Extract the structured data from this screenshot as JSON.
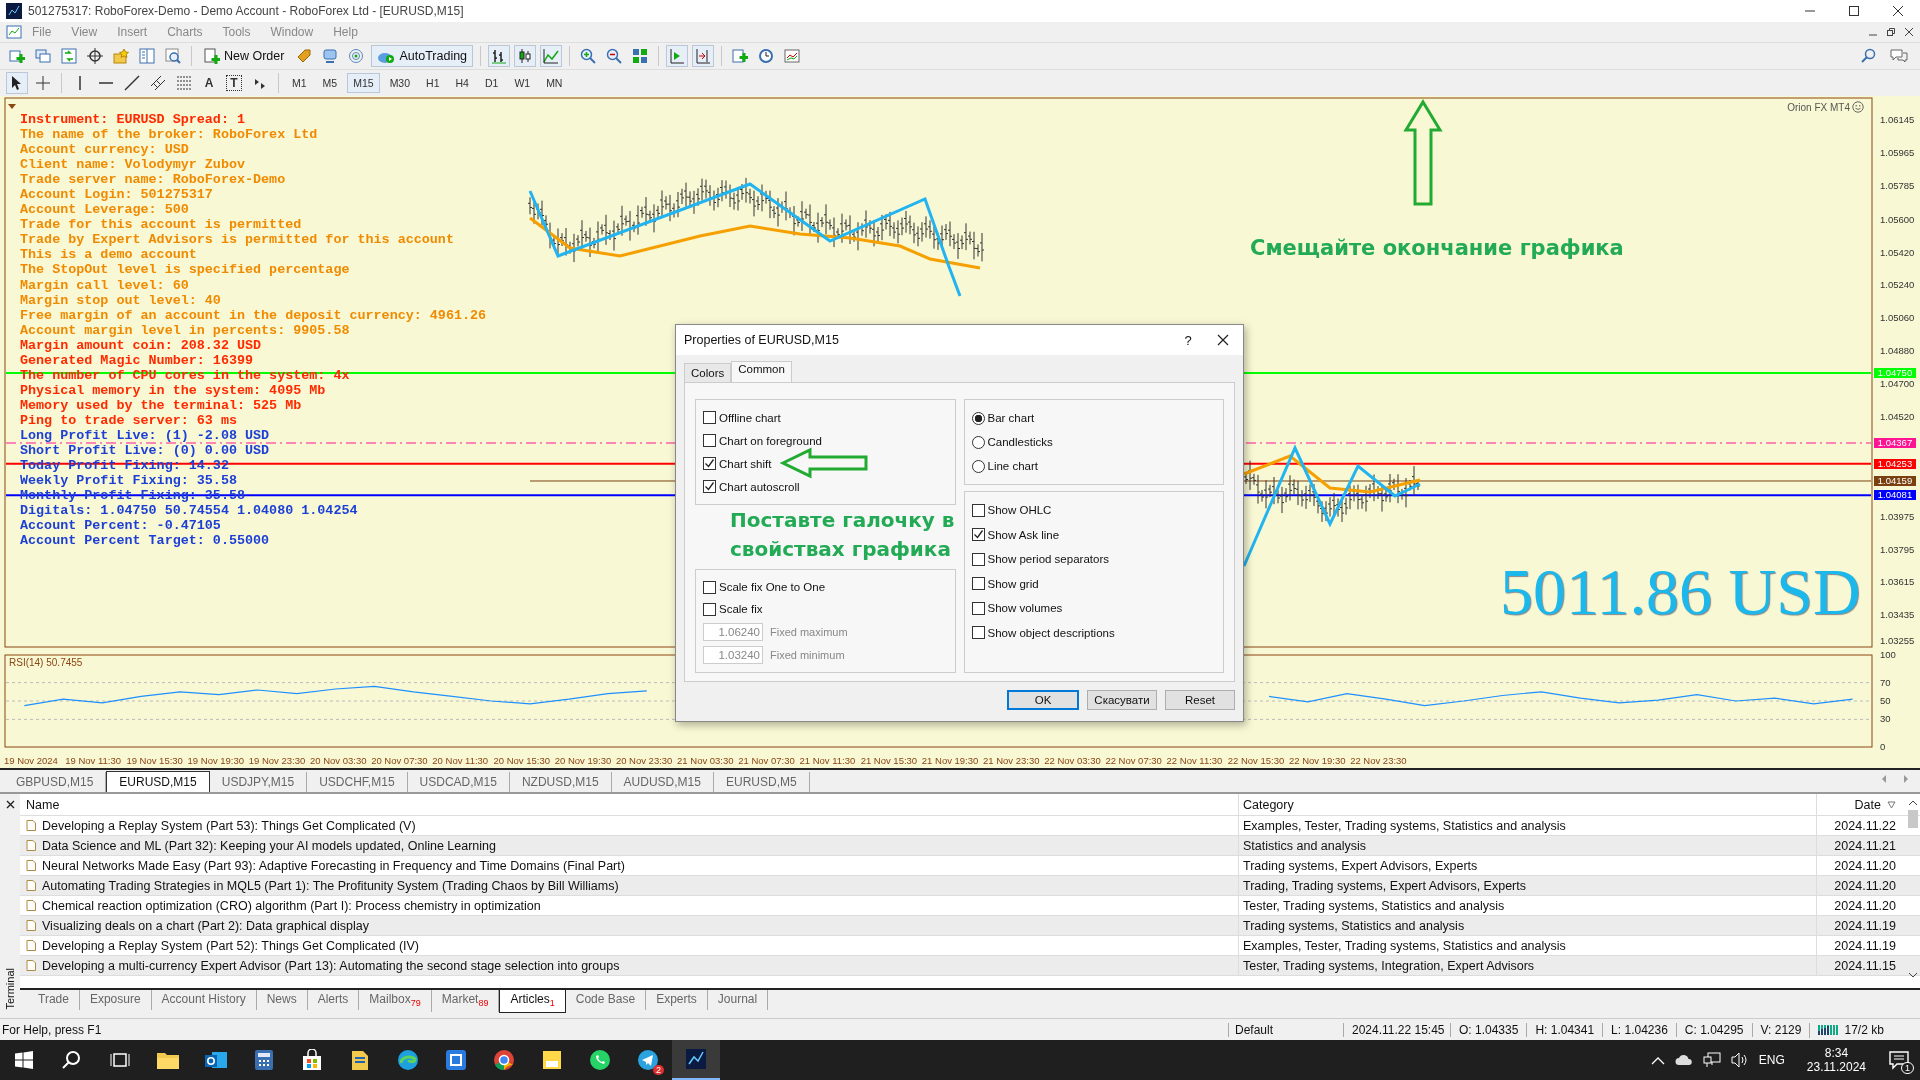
{
  "window": {
    "title": "501275317: RoboForex-Demo - Demo Account - RoboForex Ltd - [EURUSD,M15]"
  },
  "menu": [
    "File",
    "View",
    "Insert",
    "Charts",
    "Tools",
    "Window",
    "Help"
  ],
  "toolbar": {
    "new_order": "New Order",
    "autotrading": "AutoTrading"
  },
  "text_tools": [
    "A",
    "T"
  ],
  "timeframes": [
    {
      "label": "M1",
      "selected": false
    },
    {
      "label": "M5",
      "selected": false
    },
    {
      "label": "M15",
      "selected": true
    },
    {
      "label": "M30",
      "selected": false
    },
    {
      "label": "H1",
      "selected": false
    },
    {
      "label": "H4",
      "selected": false
    },
    {
      "label": "D1",
      "selected": false
    },
    {
      "label": "W1",
      "selected": false
    },
    {
      "label": "MN",
      "selected": false
    }
  ],
  "chart": {
    "info_lines": [
      {
        "text": "Instrument: EURUSD Spread: 1",
        "color": "#ff2a00"
      },
      {
        "text": "The name of the broker: RoboForex Ltd",
        "color": "#f08a00"
      },
      {
        "text": "Account currency: USD",
        "color": "#f08a00"
      },
      {
        "text": "Client name: Volodymyr Zubov",
        "color": "#f08a00"
      },
      {
        "text": "Trade server name: RoboForex-Demo",
        "color": "#f08a00"
      },
      {
        "text": "Account Login: 501275317",
        "color": "#f08a00"
      },
      {
        "text": "Account Leverage: 500",
        "color": "#f08a00"
      },
      {
        "text": "Trade for this account is permitted",
        "color": "#f08a00"
      },
      {
        "text": "Trade by Expert Advisors is permitted for this account",
        "color": "#f08a00"
      },
      {
        "text": "This is a demo account",
        "color": "#f08a00"
      },
      {
        "text": "The StopOut level is specified percentage",
        "color": "#f08a00"
      },
      {
        "text": "Margin call level: 60",
        "color": "#f08a00"
      },
      {
        "text": "Margin stop out level: 40",
        "color": "#f08a00"
      },
      {
        "text": "Free margin of an account in the deposit currency: 4961.26",
        "color": "#f08a00"
      },
      {
        "text": "Account margin level in percents: 9905.58",
        "color": "#f08a00"
      },
      {
        "text": "Margin amount coin: 208.32 USD",
        "color": "#ff2a00"
      },
      {
        "text": "Generated Magic Number: 16399",
        "color": "#ff2a00"
      },
      {
        "text": "The number of CPU cores in the system: 4x",
        "color": "#ff2a00"
      },
      {
        "text": "Physical memory in the system: 4095 Mb",
        "color": "#ff2a00"
      },
      {
        "text": "Memory used by the terminal: 525 Mb",
        "color": "#ff2a00"
      },
      {
        "text": "Ping to trade server: 63 ms",
        "color": "#ff2a00"
      },
      {
        "text": "Long Profit Live: (1) -2.08 USD",
        "color": "#1c3fd6"
      },
      {
        "text": "Short Profit Live: (0) 0.00 USD",
        "color": "#1c3fd6"
      },
      {
        "text": "Today Profit Fixing: 14.32",
        "color": "#1c3fd6"
      },
      {
        "text": "Weekly Profit Fixing: 35.58",
        "color": "#1c3fd6"
      },
      {
        "text": "Monthly Profit Fixing: 35.58",
        "color": "#1c3fd6"
      },
      {
        "text": "Digitals: 1.04750 50.74554 1.04080 1.04254",
        "color": "#1c3fd6"
      },
      {
        "text": "Account Percent: -0.47105",
        "color": "#1c3fd6"
      },
      {
        "text": "Account Percent Target: 0.55000",
        "color": "#1c3fd6"
      }
    ],
    "brand": "Orion FX MT4",
    "hint": "Смещайте окончание графика",
    "balance": "5011.86 USD",
    "price_axis": [
      "1.06145",
      "1.05965",
      "1.05785",
      "1.05600",
      "1.05420",
      "1.05240",
      "1.05060",
      "1.04880",
      "1.04700",
      "1.04520",
      "1.03975",
      "1.03795",
      "1.03615",
      "1.03435",
      "1.03255"
    ],
    "levels": [
      {
        "value": "1.04750",
        "color": "#00ff00",
        "kind": "solid"
      },
      {
        "value": "1.04367",
        "color": "#ff1493",
        "kind": "dashed"
      },
      {
        "value": "1.04253",
        "color": "#ff0000",
        "kind": "solid"
      },
      {
        "value": "1.04159",
        "color": "#7a4010",
        "kind": "short"
      },
      {
        "value": "1.04081",
        "color": "#0000ff",
        "kind": "solid"
      }
    ]
  },
  "rsi": {
    "chart_data": {
      "type": "line",
      "title": "RSI(14) 50.7455",
      "ylim": [
        0,
        100
      ],
      "yticks": [
        100,
        70,
        50,
        30,
        0
      ],
      "grid": true,
      "series": [
        {
          "color": "#1e90ff",
          "values": [
            45,
            52,
            48,
            55,
            60,
            57,
            62,
            58,
            63,
            66,
            60,
            55,
            50,
            47,
            52,
            58,
            61,
            null,
            null,
            null,
            null,
            null,
            null,
            null,
            null,
            null,
            null,
            null,
            null,
            null,
            null,
            null,
            55,
            49,
            58,
            52,
            45,
            50,
            56,
            60,
            53,
            48,
            51,
            57,
            50,
            53,
            47,
            52
          ]
        }
      ]
    }
  },
  "time_axis": [
    "19 Nov 2024",
    "19 Nov 11:30",
    "19 Nov 15:30",
    "19 Nov 19:30",
    "19 Nov 23:30",
    "20 Nov 03:30",
    "20 Nov 07:30",
    "20 Nov 11:30",
    "20 Nov 15:30",
    "20 Nov 19:30",
    "20 Nov 23:30",
    "21 Nov 03:30",
    "21 Nov 07:30",
    "21 Nov 11:30",
    "21 Nov 15:30",
    "21 Nov 19:30",
    "21 Nov 23:30",
    "22 Nov 03:30",
    "22 Nov 07:30",
    "22 Nov 11:30",
    "22 Nov 15:30",
    "22 Nov 19:30",
    "22 Nov 23:30"
  ],
  "chart_tabs": [
    {
      "label": "GBPUSD,M15",
      "selected": false
    },
    {
      "label": "EURUSD,M15",
      "selected": true
    },
    {
      "label": "USDJPY,M15",
      "selected": false
    },
    {
      "label": "USDCHF,M15",
      "selected": false
    },
    {
      "label": "USDCAD,M15",
      "selected": false
    },
    {
      "label": "NZDUSD,M15",
      "selected": false
    },
    {
      "label": "AUDUSD,M15",
      "selected": false
    },
    {
      "label": "EURUSD,M5",
      "selected": false
    }
  ],
  "dialog": {
    "title": "Properties of EURUSD,M15",
    "help": "?",
    "tabs": [
      {
        "label": "Colors",
        "selected": false
      },
      {
        "label": "Common",
        "selected": true
      }
    ],
    "options": [
      {
        "label": "Offline chart",
        "checked": false
      },
      {
        "label": "Chart on foreground",
        "checked": false
      },
      {
        "label": "Chart shift",
        "checked": true
      },
      {
        "label": "Chart autoscroll",
        "checked": true
      }
    ],
    "scale": [
      {
        "label": "Scale fix One to One",
        "checked": false
      },
      {
        "label": "Scale fix",
        "checked": false
      }
    ],
    "fixed": [
      {
        "value": "1.06240",
        "label": "Fixed maximum",
        "disabled": true
      },
      {
        "value": "1.03240",
        "label": "Fixed minimum",
        "disabled": true
      }
    ],
    "chart_types": [
      {
        "label": "Bar chart",
        "selected": true
      },
      {
        "label": "Candlesticks",
        "selected": false
      },
      {
        "label": "Line chart",
        "selected": false
      }
    ],
    "show": [
      {
        "label": "Show OHLC",
        "checked": false
      },
      {
        "label": "Show Ask line",
        "checked": true
      },
      {
        "label": "Show period separators",
        "checked": false
      },
      {
        "label": "Show grid",
        "checked": false
      },
      {
        "label": "Show volumes",
        "checked": false
      },
      {
        "label": "Show object descriptions",
        "checked": false
      }
    ],
    "annotation": [
      "Поставте галочку в",
      "свойствах графика"
    ],
    "buttons": [
      {
        "label": "OK",
        "default": true
      },
      {
        "label": "Скасувати",
        "default": false
      },
      {
        "label": "Reset",
        "default": false
      }
    ]
  },
  "terminal": {
    "side_label": "Terminal",
    "columns": [
      "Name",
      "Category",
      "Date"
    ],
    "rows": [
      {
        "name": "Developing a Replay System (Part 53): Things Get Complicated (V)",
        "category": "Examples, Tester, Trading systems, Statistics and analysis",
        "date": "2024.11.22"
      },
      {
        "name": "Data Science and ML (Part 32): Keeping your AI models updated, Online Learning",
        "category": "Statistics and analysis",
        "date": "2024.11.21"
      },
      {
        "name": "Neural Networks Made Easy (Part 93): Adaptive Forecasting in Frequency and Time Domains (Final Part)",
        "category": "Trading systems, Expert Advisors, Experts",
        "date": "2024.11.20"
      },
      {
        "name": "Automating Trading Strategies in MQL5 (Part 1): The Profitunity System (Trading Chaos by Bill Williams)",
        "category": "Trading, Trading systems, Expert Advisors, Experts",
        "date": "2024.11.20"
      },
      {
        "name": "Chemical reaction optimization (CRO) algorithm (Part I): Process chemistry in optimization",
        "category": "Tester, Trading systems, Statistics and analysis",
        "date": "2024.11.20"
      },
      {
        "name": "Visualizing deals on a chart (Part 2): Data graphical display",
        "category": "Trading systems, Statistics and analysis",
        "date": "2024.11.19"
      },
      {
        "name": "Developing a Replay System (Part 52): Things Get Complicated (IV)",
        "category": "Examples, Tester, Trading systems, Statistics and analysis",
        "date": "2024.11.19"
      },
      {
        "name": "Developing a multi-currency Expert Advisor (Part 13): Automating the second stage  selection into groups",
        "category": "Tester, Trading systems, Integration, Expert Advisors",
        "date": "2024.11.15"
      }
    ],
    "tabs": [
      {
        "label": "Trade",
        "selected": false
      },
      {
        "label": "Exposure",
        "selected": false
      },
      {
        "label": "Account History",
        "selected": false
      },
      {
        "label": "News",
        "selected": false
      },
      {
        "label": "Alerts",
        "selected": false
      },
      {
        "label": "Mailbox",
        "count": "79",
        "selected": false
      },
      {
        "label": "Market",
        "count": "89",
        "selected": false
      },
      {
        "label": "Articles",
        "count": "1",
        "selected": true
      },
      {
        "label": "Code Base",
        "selected": false
      },
      {
        "label": "Experts",
        "selected": false
      },
      {
        "label": "Journal",
        "selected": false
      }
    ]
  },
  "status_bar": {
    "help": "For Help, press F1",
    "profile": "Default",
    "fields": [
      "2024.11.22 15:45",
      "O: 1.04335",
      "H: 1.04341",
      "L: 1.04236",
      "C: 1.04295",
      "V: 2129"
    ],
    "traffic": "17/2 kb"
  },
  "taskbar": {
    "app_badge": "2",
    "language": "ENG",
    "time": "8:34",
    "date": "23.11.2024",
    "notifications": "1"
  }
}
